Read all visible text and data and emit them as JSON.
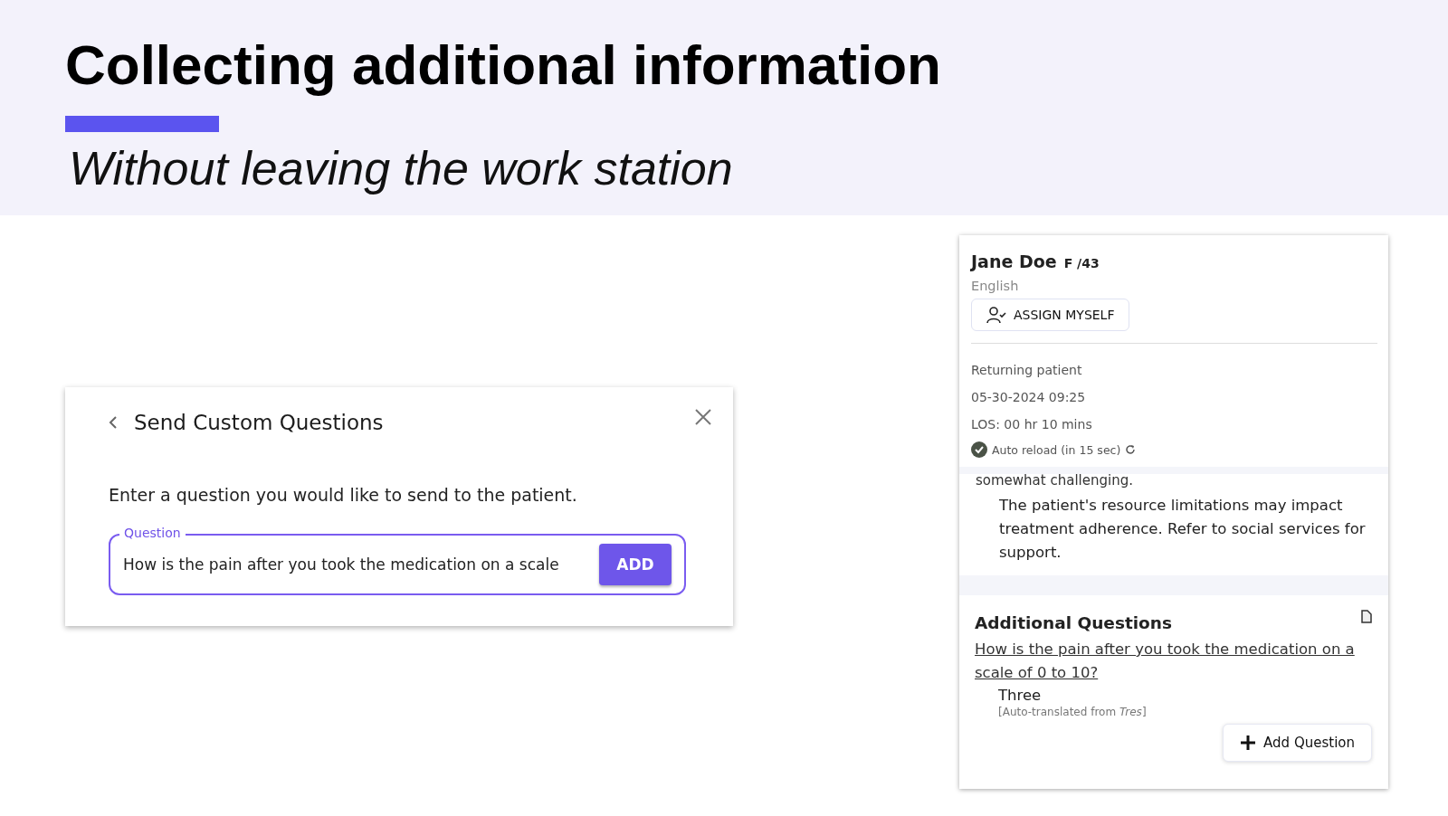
{
  "header": {
    "title": "Collecting additional information",
    "subtitle": "Without leaving the work station"
  },
  "dialog": {
    "title": "Send Custom Questions",
    "instruction": "Enter a question you would like to send to the patient.",
    "field": {
      "label": "Question",
      "value": "How is the pain after you took the medication on a scale"
    },
    "button": "ADD"
  },
  "patient_card": {
    "name": "Jane Doe",
    "sex_age": "F /43",
    "language": "English",
    "assign_button": "ASSIGN MYSELF",
    "details": [
      "Returning patient",
      "05-30-2024 09:25",
      "LOS: 00 hr 10 mins"
    ],
    "auto_reload": "Auto reload (in 15 sec)",
    "notes": {
      "cut_line": "somewhat challenging.",
      "text": "The patient's resource limitations may impact treatment adherence. Refer to social services for support."
    },
    "additional_questions": {
      "title": "Additional Questions",
      "items": [
        {
          "question": "How is the pain after you took the medication on a scale of 0 to 10?",
          "answer": "Three",
          "translation": "[Auto-translated from *Tres*]"
        }
      ],
      "add_button": "Add Question"
    }
  }
}
